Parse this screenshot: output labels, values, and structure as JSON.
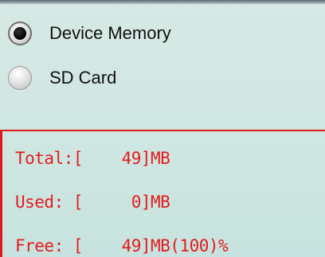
{
  "storage": {
    "options": [
      {
        "label": "Device Memory",
        "selected": true
      },
      {
        "label": "SD Card",
        "selected": false
      }
    ]
  },
  "stats": {
    "total": "Total:[    49]MB",
    "used": "Used: [     0]MB",
    "free": "Free: [    49]MB(100)%"
  },
  "colors": {
    "accent": "#e41c1c",
    "background": "#cfe6e2"
  }
}
